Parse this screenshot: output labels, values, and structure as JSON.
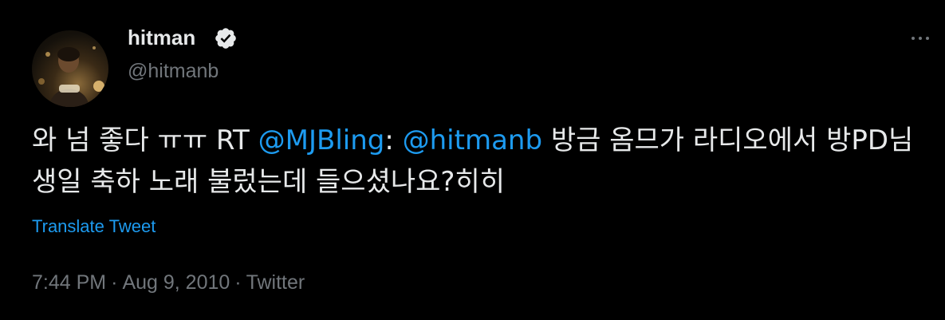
{
  "author": {
    "display_name": "hitman",
    "handle": "@hitmanb",
    "verified": true,
    "verified_icon": "verified-badge-icon"
  },
  "tweet": {
    "segments": [
      {
        "text": "와 넘 좋다 ㅠㅠ RT ",
        "type": "text"
      },
      {
        "text": "@MJBling",
        "type": "mention"
      },
      {
        "text": ": ",
        "type": "text"
      },
      {
        "text": "@hitmanb",
        "type": "mention"
      },
      {
        "text": " 방금 옴므가 라디오에서 방PD님 생일 축하 노래 불렀는데 들으셨나요?히히",
        "type": "text"
      }
    ]
  },
  "translate_label": "Translate Tweet",
  "meta": {
    "time": "7:44 PM",
    "separator": "·",
    "date": "Aug 9, 2010",
    "source": "Twitter"
  },
  "colors": {
    "background": "#000000",
    "text": "#e7e9ea",
    "secondary": "#71767b",
    "link": "#1d9bf0"
  }
}
